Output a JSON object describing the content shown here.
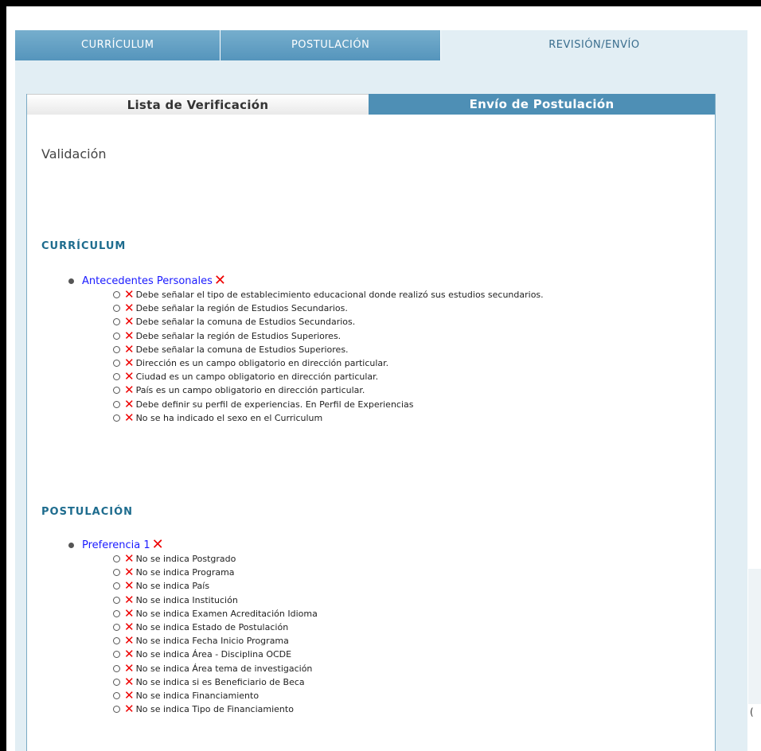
{
  "main_tabs": [
    "CURRÍCULUM",
    "POSTULACIÓN",
    "REVISIÓN/ENVÍO"
  ],
  "sub_tabs": [
    "Lista de Verificación",
    "Envío de Postulación"
  ],
  "heading": "Validación",
  "marks": {
    "error": "✕",
    "bullet": "●",
    "sub_bullet": "○"
  },
  "edge_char": "(",
  "sections": [
    {
      "title": "CURRÍCULUM",
      "groups": [
        {
          "label": "Antecedentes Personales",
          "items": [
            "Debe señalar el tipo de establecimiento educacional donde realizó sus estudios secundarios.",
            "Debe señalar la región de Estudios Secundarios.",
            "Debe señalar la comuna de Estudios Secundarios.",
            "Debe señalar la región de Estudios Superiores.",
            "Debe señalar la comuna de Estudios Superiores.",
            "Dirección es un campo obligatorio en dirección particular.",
            "Ciudad es un campo obligatorio en dirección particular.",
            "País es un campo obligatorio en dirección particular.",
            "Debe definir su perfil de experiencias. En Perfil de Experiencias",
            "No se ha indicado el sexo en el Curriculum"
          ]
        }
      ]
    },
    {
      "title": "POSTULACIÓN",
      "groups": [
        {
          "label": "Preferencia 1",
          "items": [
            "No se indica Postgrado",
            "No se indica Programa",
            "No se indica País",
            "No se indica Institución",
            "No se indica Examen Acreditación Idioma",
            "No se indica Estado de Postulación",
            "No se indica Fecha Inicio Programa",
            "No se indica Área - Disciplina OCDE",
            "No se indica Área tema de investigación",
            "No se indica si es Beneficiario de Beca",
            "No se indica Financiamiento",
            "No se indica Tipo de Financiamiento"
          ]
        }
      ]
    }
  ]
}
